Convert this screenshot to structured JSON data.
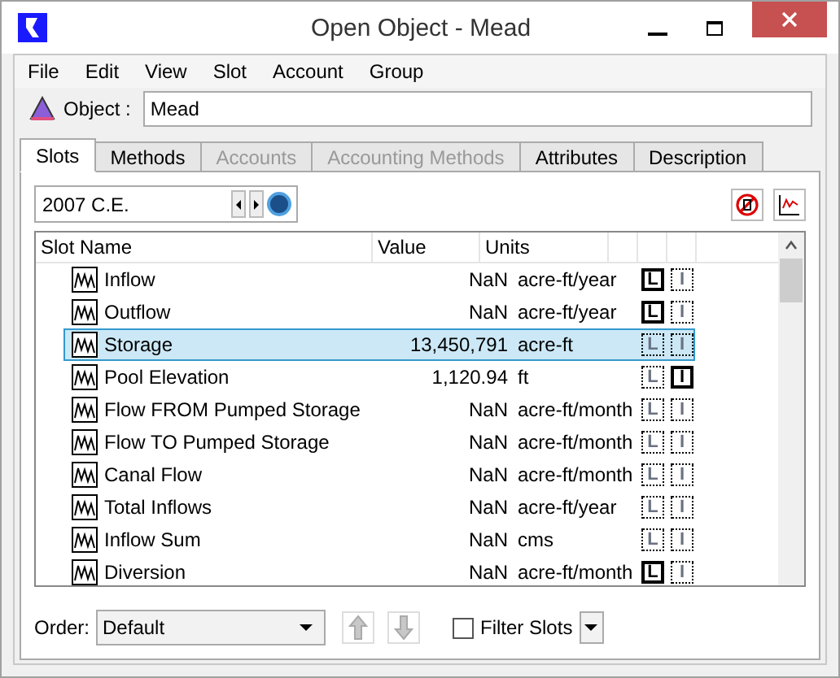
{
  "window": {
    "title": "Open Object - Mead"
  },
  "menu": [
    "File",
    "Edit",
    "View",
    "Slot",
    "Account",
    "Group"
  ],
  "object": {
    "label": "Object :",
    "value": "Mead"
  },
  "tabs": [
    {
      "label": "Slots",
      "selected": true,
      "disabled": false
    },
    {
      "label": "Methods",
      "selected": false,
      "disabled": false
    },
    {
      "label": "Accounts",
      "selected": false,
      "disabled": true
    },
    {
      "label": "Accounting Methods",
      "selected": false,
      "disabled": true
    },
    {
      "label": "Attributes",
      "selected": false,
      "disabled": false
    },
    {
      "label": "Description",
      "selected": false,
      "disabled": false
    }
  ],
  "timestep": {
    "value": "2007 C.E."
  },
  "table": {
    "columns": [
      "Slot Name",
      "Value",
      "Units"
    ],
    "rows": [
      {
        "name": "Inflow",
        "value": "NaN",
        "units": "acre-ft/year",
        "selected": false,
        "flags": [
          {
            "letter": "L",
            "on": true
          },
          {
            "letter": "I",
            "on": false
          }
        ]
      },
      {
        "name": "Outflow",
        "value": "NaN",
        "units": "acre-ft/year",
        "selected": false,
        "flags": [
          {
            "letter": "L",
            "on": true
          },
          {
            "letter": "I",
            "on": false
          }
        ]
      },
      {
        "name": "Storage",
        "value": "13,450,791",
        "units": "acre-ft",
        "selected": true,
        "flags": [
          {
            "letter": "L",
            "on": false
          },
          {
            "letter": "I",
            "on": false
          }
        ]
      },
      {
        "name": "Pool Elevation",
        "value": "1,120.94",
        "units": "ft",
        "selected": false,
        "flags": [
          {
            "letter": "L",
            "on": false
          },
          {
            "letter": "I",
            "on": true
          }
        ]
      },
      {
        "name": "Flow FROM Pumped Storage",
        "value": "NaN",
        "units": "acre-ft/month",
        "selected": false,
        "flags": [
          {
            "letter": "L",
            "on": false
          },
          {
            "letter": "I",
            "on": false
          }
        ]
      },
      {
        "name": "Flow TO Pumped Storage",
        "value": "NaN",
        "units": "acre-ft/month",
        "selected": false,
        "flags": [
          {
            "letter": "L",
            "on": false
          },
          {
            "letter": "I",
            "on": false
          }
        ]
      },
      {
        "name": "Canal Flow",
        "value": "NaN",
        "units": "acre-ft/month",
        "selected": false,
        "flags": [
          {
            "letter": "L",
            "on": false
          },
          {
            "letter": "I",
            "on": false
          }
        ]
      },
      {
        "name": "Total Inflows",
        "value": "NaN",
        "units": "acre-ft/year",
        "selected": false,
        "flags": [
          {
            "letter": "L",
            "on": false
          },
          {
            "letter": "I",
            "on": false
          }
        ]
      },
      {
        "name": "Inflow Sum",
        "value": "NaN",
        "units": "cms",
        "selected": false,
        "flags": [
          {
            "letter": "L",
            "on": false
          },
          {
            "letter": "I",
            "on": false
          }
        ]
      },
      {
        "name": "Diversion",
        "value": "NaN",
        "units": "acre-ft/month",
        "selected": false,
        "flags": [
          {
            "letter": "L",
            "on": true
          },
          {
            "letter": "I",
            "on": false
          }
        ]
      }
    ]
  },
  "bottom": {
    "order_label": "Order:",
    "order_value": "Default",
    "filter": {
      "label": "Filter Slots",
      "checked": false
    }
  }
}
